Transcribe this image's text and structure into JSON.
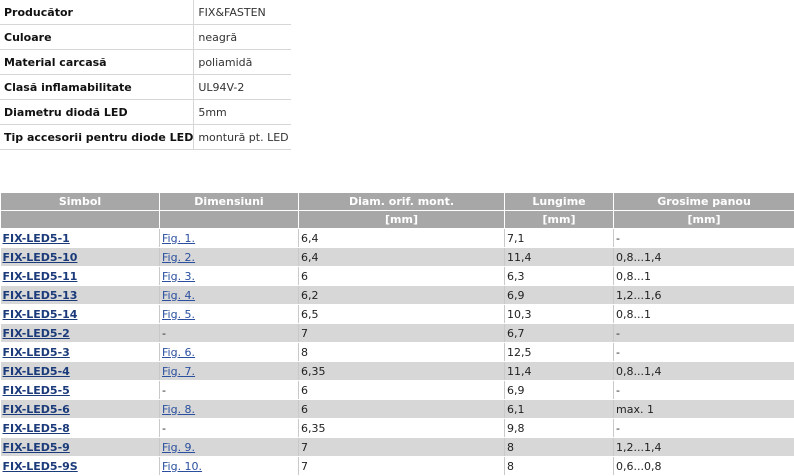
{
  "specs": [
    {
      "label": "Producător",
      "value": "FIX&FASTEN"
    },
    {
      "label": "Culoare",
      "value": "neagră"
    },
    {
      "label": "Material carcasă",
      "value": "poliamidă"
    },
    {
      "label": "Clasă inflamabilitate",
      "value": "UL94V-2"
    },
    {
      "label": "Diametru diodă LED",
      "value": "5mm"
    },
    {
      "label": "Tip accesorii pentru diode LED",
      "value": "montură pt. LED"
    }
  ],
  "table": {
    "headers": [
      "Simbol",
      "Dimensiuni",
      "Diam. orif. mont.",
      "Lungime",
      "Grosime panou"
    ],
    "units": [
      "",
      "",
      "[mm]",
      "[mm]",
      "[mm]"
    ],
    "rows": [
      {
        "symbol": "FIX-LED5-1",
        "fig": "Fig. 1.",
        "diam": "6,4",
        "length": "7,1",
        "panel": "-"
      },
      {
        "symbol": "FIX-LED5-10",
        "fig": "Fig. 2.",
        "diam": "6,4",
        "length": "11,4",
        "panel": "0,8...1,4"
      },
      {
        "symbol": "FIX-LED5-11",
        "fig": "Fig. 3.",
        "diam": "6",
        "length": "6,3",
        "panel": "0,8...1"
      },
      {
        "symbol": "FIX-LED5-13",
        "fig": "Fig. 4.",
        "diam": "6,2",
        "length": "6,9",
        "panel": "1,2...1,6"
      },
      {
        "symbol": "FIX-LED5-14",
        "fig": "Fig. 5.",
        "diam": "6,5",
        "length": "10,3",
        "panel": "0,8...1"
      },
      {
        "symbol": "FIX-LED5-2",
        "fig": "-",
        "diam": "7",
        "length": "6,7",
        "panel": "-"
      },
      {
        "symbol": "FIX-LED5-3",
        "fig": "Fig. 6.",
        "diam": "8",
        "length": "12,5",
        "panel": "-"
      },
      {
        "symbol": "FIX-LED5-4",
        "fig": "Fig. 7.",
        "diam": "6,35",
        "length": "11,4",
        "panel": "0,8...1,4"
      },
      {
        "symbol": "FIX-LED5-5",
        "fig": "-",
        "diam": "6",
        "length": "6,9",
        "panel": "-"
      },
      {
        "symbol": "FIX-LED5-6",
        "fig": "Fig. 8.",
        "diam": "6",
        "length": "6,1",
        "panel": "max. 1"
      },
      {
        "symbol": "FIX-LED5-8",
        "fig": "-",
        "diam": "6,35",
        "length": "9,8",
        "panel": "-"
      },
      {
        "symbol": "FIX-LED5-9",
        "fig": "Fig. 9.",
        "diam": "7",
        "length": "8",
        "panel": "1,2...1,4"
      },
      {
        "symbol": "FIX-LED5-9S",
        "fig": "Fig. 10.",
        "diam": "7",
        "length": "8",
        "panel": "0,6...0,8"
      }
    ]
  }
}
